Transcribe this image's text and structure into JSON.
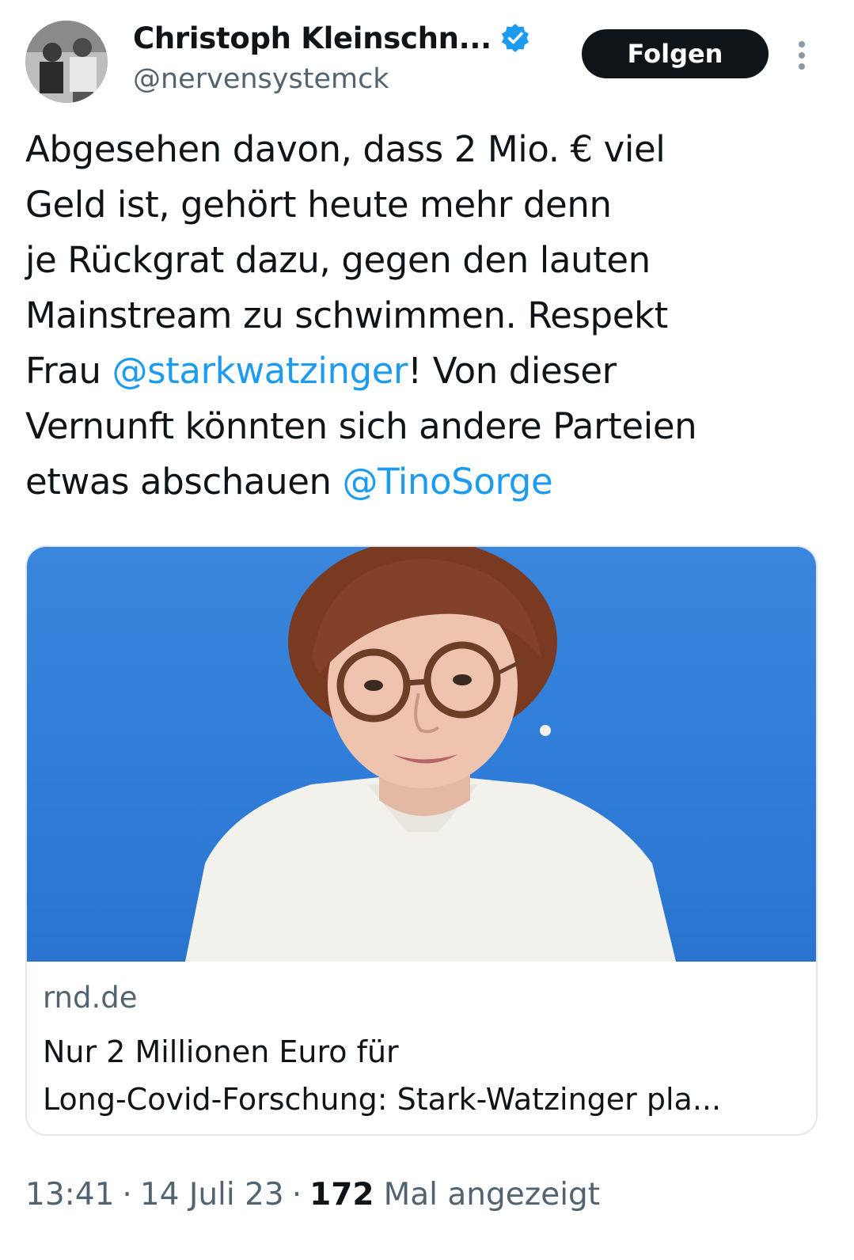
{
  "author": {
    "display_name": "Christoph Kleinschn...",
    "handle": "@nervensystemck"
  },
  "follow_button_label": "Folgen",
  "tweet": {
    "lines": [
      [
        "Abgesehen davon, dass 2 Mio. € viel"
      ],
      [
        "Geld ist, gehört heute mehr denn"
      ],
      [
        "je Rückgrat dazu, gegen den lauten"
      ],
      [
        "Mainstream zu schwimmen. Respekt"
      ],
      [
        "Frau ",
        "@starkwatzinger",
        "! Von dieser"
      ],
      [
        "Vernunft könnten sich andere Parteien"
      ],
      [
        "etwas abschauen ",
        "@TinoSorge"
      ]
    ]
  },
  "link_card": {
    "domain": "rnd.de",
    "title_line_1": "Nur 2 Millionen Euro für",
    "title_line_2": "Long-Covid-Forschung: Stark-Watzinger pla..."
  },
  "meta": {
    "time": "13:41",
    "date": "14 Juli 23",
    "views_count": "172",
    "views_label": "Mal angezeigt",
    "separator": "·"
  },
  "colors": {
    "mention": "#1d9bf0",
    "secondary_text": "#536471",
    "follow_button_bg": "#0f1419",
    "verified": "#1d9bf0"
  },
  "icons": {
    "verified": "verified-badge-icon",
    "more": "more-vertical-icon"
  }
}
